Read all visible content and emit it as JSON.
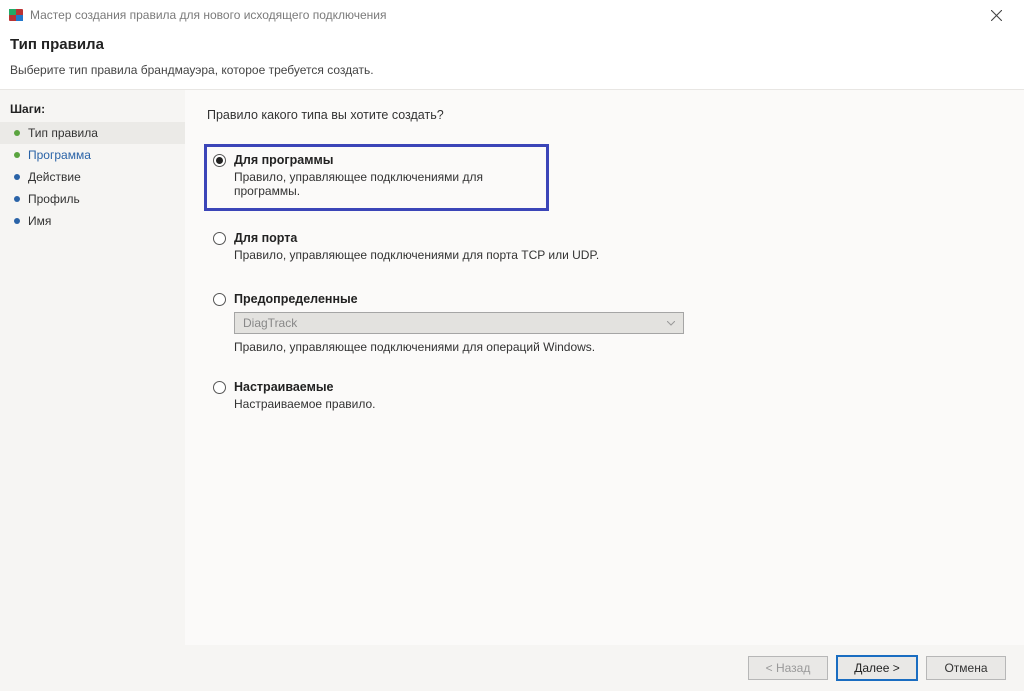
{
  "titlebar": {
    "title": "Мастер создания правила для нового исходящего подключения"
  },
  "header": {
    "title": "Тип правила",
    "subtitle": "Выберите тип правила брандмауэра, которое требуется создать."
  },
  "sidebar": {
    "heading": "Шаги:",
    "items": [
      {
        "label": "Тип правила"
      },
      {
        "label": "Программа"
      },
      {
        "label": "Действие"
      },
      {
        "label": "Профиль"
      },
      {
        "label": "Имя"
      }
    ]
  },
  "content": {
    "prompt": "Правило какого типа вы хотите создать?",
    "options": {
      "program": {
        "label": "Для программы",
        "desc": "Правило, управляющее подключениями для программы."
      },
      "port": {
        "label": "Для порта",
        "desc": "Правило, управляющее подключениями для порта TCP или UDP."
      },
      "predefined": {
        "label": "Предопределенные",
        "select_value": "DiagTrack",
        "desc": "Правило, управляющее подключениями для операций Windows."
      },
      "custom": {
        "label": "Настраиваемые",
        "desc": "Настраиваемое правило."
      }
    }
  },
  "footer": {
    "back": "< Назад",
    "next": "Далее >",
    "cancel": "Отмена"
  }
}
